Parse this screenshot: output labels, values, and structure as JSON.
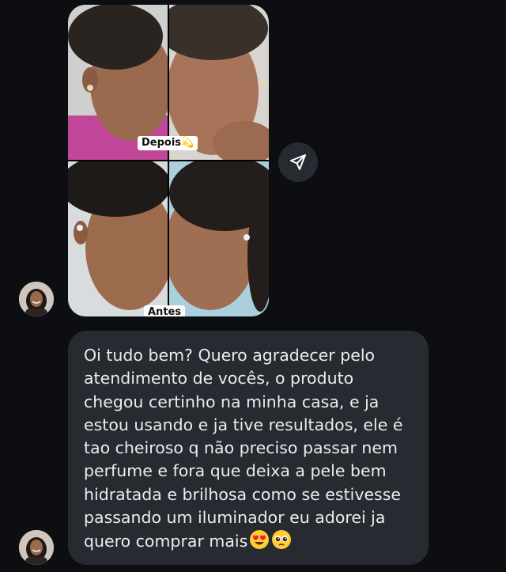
{
  "message_image": {
    "label_top": "Depois💫",
    "label_bottom": "Antes"
  },
  "message_text": {
    "body": "Oi tudo bem? Quero agradecer pelo\natendimento de vocês, o produto\nchegou certinho na minha casa, e ja\nestou usando e ja tive resultados, ele é\ntao cheiroso q não preciso passar nem\nperfume e fora que deixa a pele bem\nhidratada e brilhosa como se estivesse\npassando um iluminador eu adorei ja\nquero comprar mais",
    "emojis": [
      "heart-eyes-emoji",
      "pleading-face-emoji"
    ]
  },
  "icons": {
    "share": "send-paper-plane-icon",
    "avatar": "sender-avatar"
  },
  "colors": {
    "background": "#0c0e12",
    "bubble": "#272a31",
    "text": "#ececec",
    "share_button": "#262a31"
  }
}
